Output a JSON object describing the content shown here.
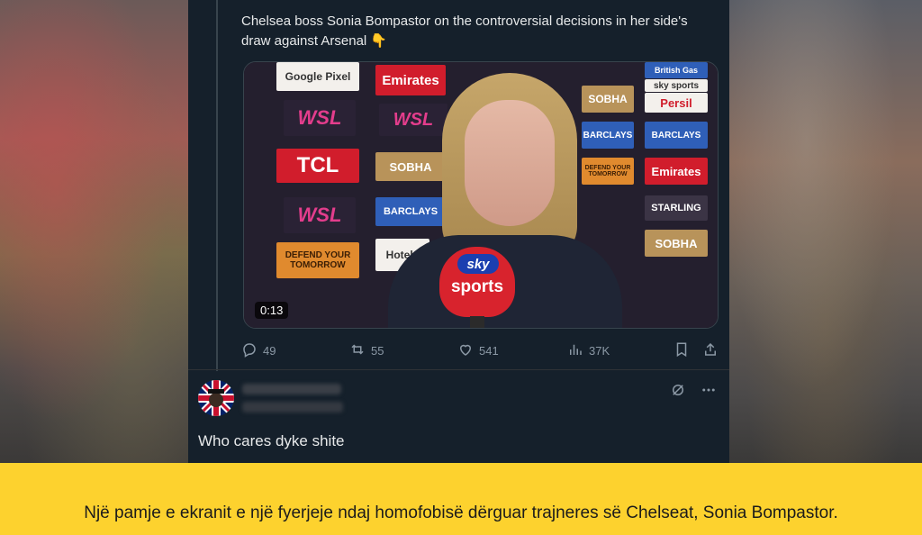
{
  "tweet": {
    "text": "Chelsea boss Sonia Bompastor on the controversial decisions in her side's draw against Arsenal 👇",
    "video": {
      "timestamp": "0:13",
      "sponsor_tiles": [
        "Google Pixel",
        "Emirates",
        "WSL",
        "BARCLAYS",
        "SOBHA",
        "British Gas",
        "sky sports",
        "Persil",
        "TCL",
        "DEFEND YOUR TOMORROW",
        "STARLING",
        "Hotels"
      ],
      "mic": {
        "brand_top": "sky",
        "brand_bottom": "sports"
      }
    },
    "actions": {
      "replies": "49",
      "reposts": "55",
      "likes": "541",
      "views": "37K"
    }
  },
  "reply": {
    "text": "Who cares dyke shite"
  },
  "caption": {
    "text": "Një pamje e ekranit e një fyerjeje ndaj homofobisë dërguar trajneres së Chelseat, Sonia Bompastor."
  },
  "colors": {
    "panel_bg": "#15202b",
    "caption_bg": "#fdd22e",
    "text_primary": "#e7e9ea",
    "text_secondary": "#8b98a5"
  }
}
